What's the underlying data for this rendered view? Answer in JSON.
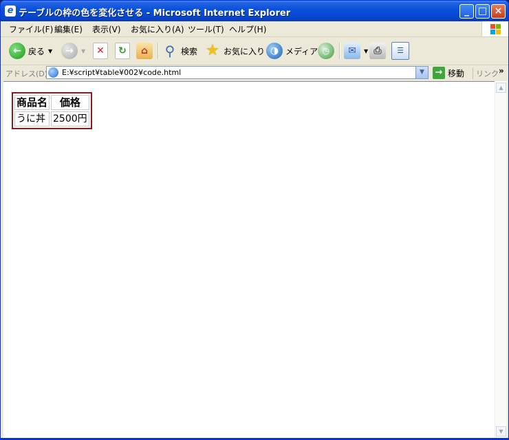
{
  "window": {
    "title": "テーブルの枠の色を変化させる - Microsoft Internet Explorer",
    "controls": [
      "_",
      "□",
      "×"
    ]
  },
  "menu": {
    "items": [
      "ファイル(F)",
      "編集(E)",
      "表示(V)",
      "お気に入り(A)",
      "ツール(T)",
      "ヘルプ(H)"
    ]
  },
  "toolbar": {
    "back_label": "戻る",
    "search_label": "検索",
    "favorites_label": "お気に入り",
    "media_label": "メディア"
  },
  "address": {
    "label": "アドレス(D)",
    "url": "E:¥script¥table¥002¥code.html",
    "go_label": "移動",
    "links_label": "リンク",
    "more": "»"
  },
  "page": {
    "table": {
      "headers": [
        "商品名",
        "価格"
      ],
      "rows": [
        [
          "うに丼",
          "2500円"
        ]
      ],
      "border_color": "#8b1a1a"
    }
  }
}
